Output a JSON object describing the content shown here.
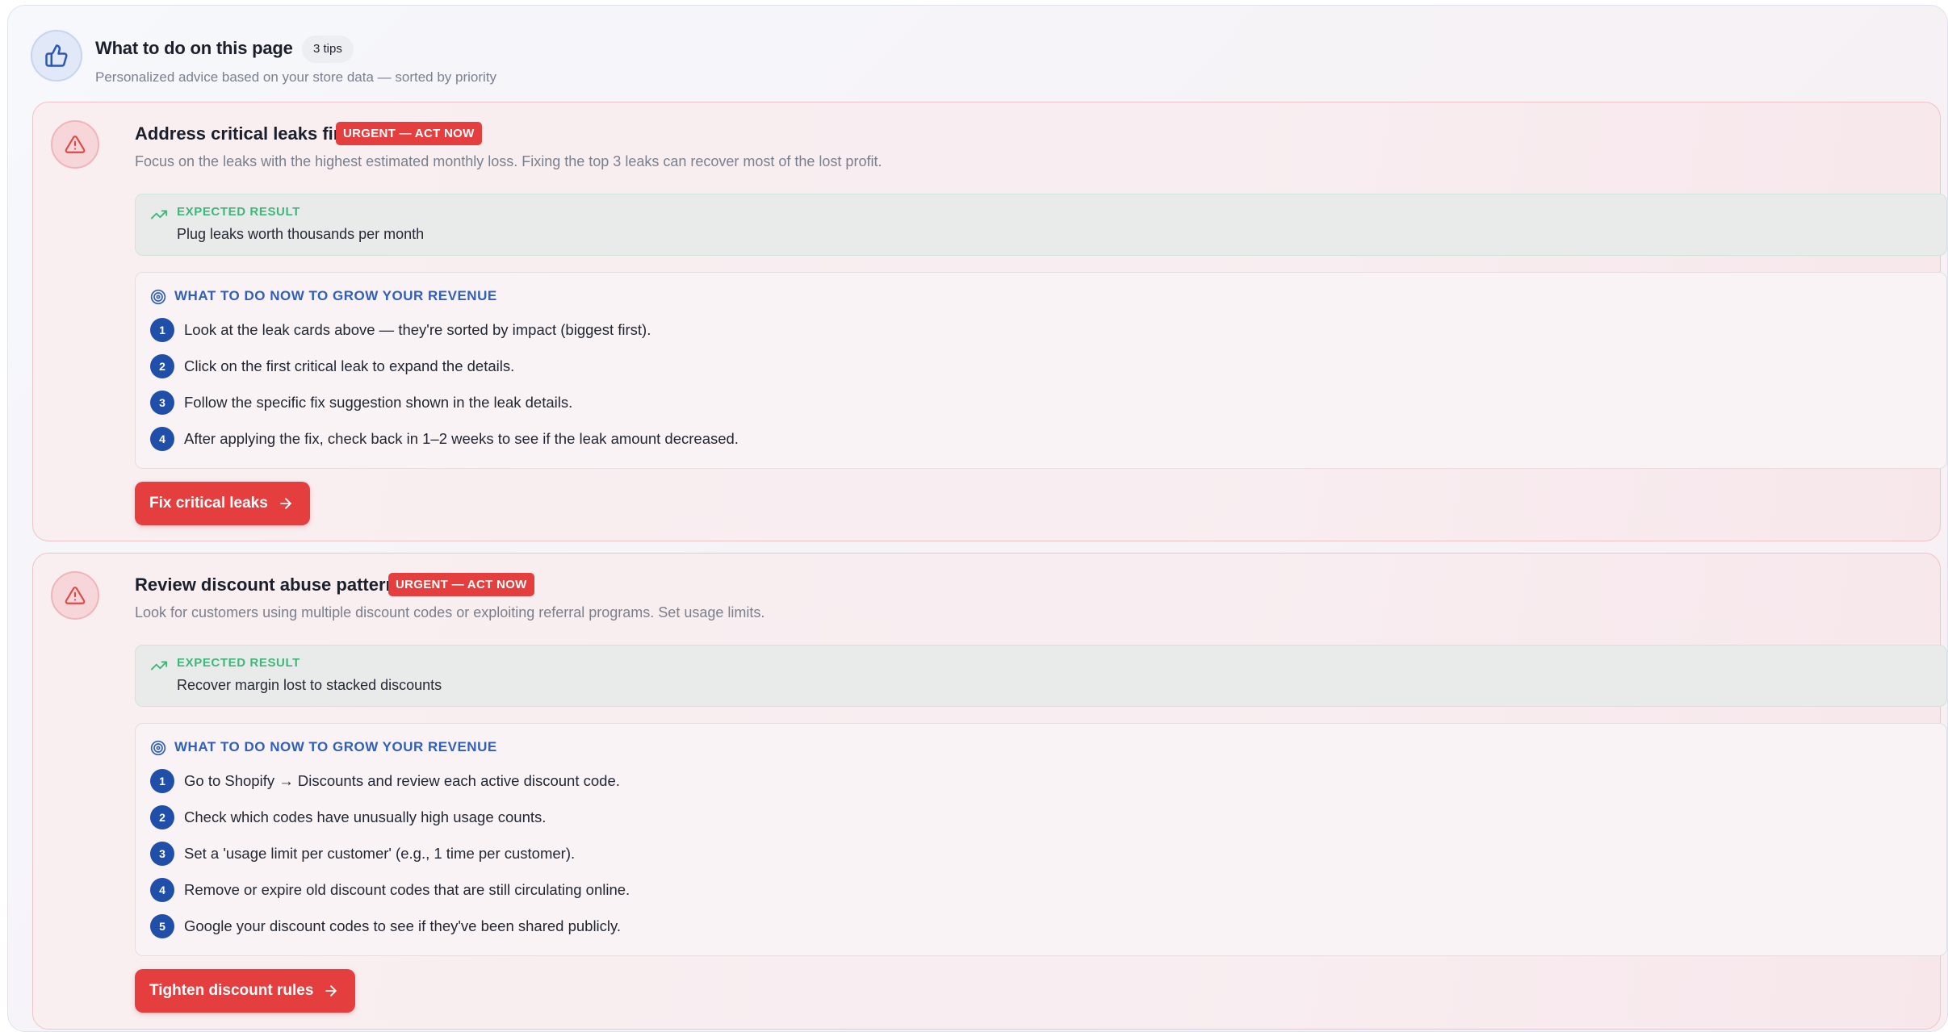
{
  "header": {
    "title": "What to do on this page",
    "badge": "3 tips",
    "subtitle": "Personalized advice based on your store data — sorted by priority",
    "icon": "thumbs-up-icon"
  },
  "tips": [
    {
      "title": "Address critical leaks first",
      "badge": "URGENT — ACT NOW",
      "description": "Focus on the leaks with the highest estimated monthly loss. Fixing the top 3 leaks can recover most of the lost profit.",
      "result_label": "EXPECTED RESULT",
      "result_text": "Plug leaks worth thousands per month",
      "steps_label": "WHAT TO DO NOW TO GROW YOUR REVENUE",
      "steps": [
        {
          "num": "1",
          "text": "Look at the leak cards above — they're sorted by impact (biggest first)."
        },
        {
          "num": "2",
          "text": "Click on the first critical leak to expand the details."
        },
        {
          "num": "3",
          "text": "Follow the specific fix suggestion shown in the leak details."
        },
        {
          "num": "4",
          "text": "After applying the fix, check back in 1–2 weeks to see if the leak amount decreased."
        }
      ],
      "cta": "Fix critical leaks"
    },
    {
      "title": "Review discount abuse patterns",
      "badge": "URGENT — ACT NOW",
      "description": "Look for customers using multiple discount codes or exploiting referral programs. Set usage limits.",
      "result_label": "EXPECTED RESULT",
      "result_text": "Recover margin lost to stacked discounts",
      "steps_label": "WHAT TO DO NOW TO GROW YOUR REVENUE",
      "steps": [
        {
          "num": "1",
          "text": "Go to Shopify → Discounts and review each active discount code."
        },
        {
          "num": "2",
          "text": "Check which codes have unusually high usage counts."
        },
        {
          "num": "3",
          "text": "Set a 'usage limit per customer' (e.g., 1 time per customer)."
        },
        {
          "num": "4",
          "text": "Remove or expire old discount codes that are still circulating online."
        },
        {
          "num": "5",
          "text": "Google your discount codes to see if they've been shared publicly."
        }
      ],
      "cta": "Tighten discount rules"
    }
  ],
  "colors": {
    "urgent": "#e53e3e",
    "step_badge": "#1f4fa8",
    "result_label": "#3fb67a",
    "steps_label": "#2f5fba"
  }
}
